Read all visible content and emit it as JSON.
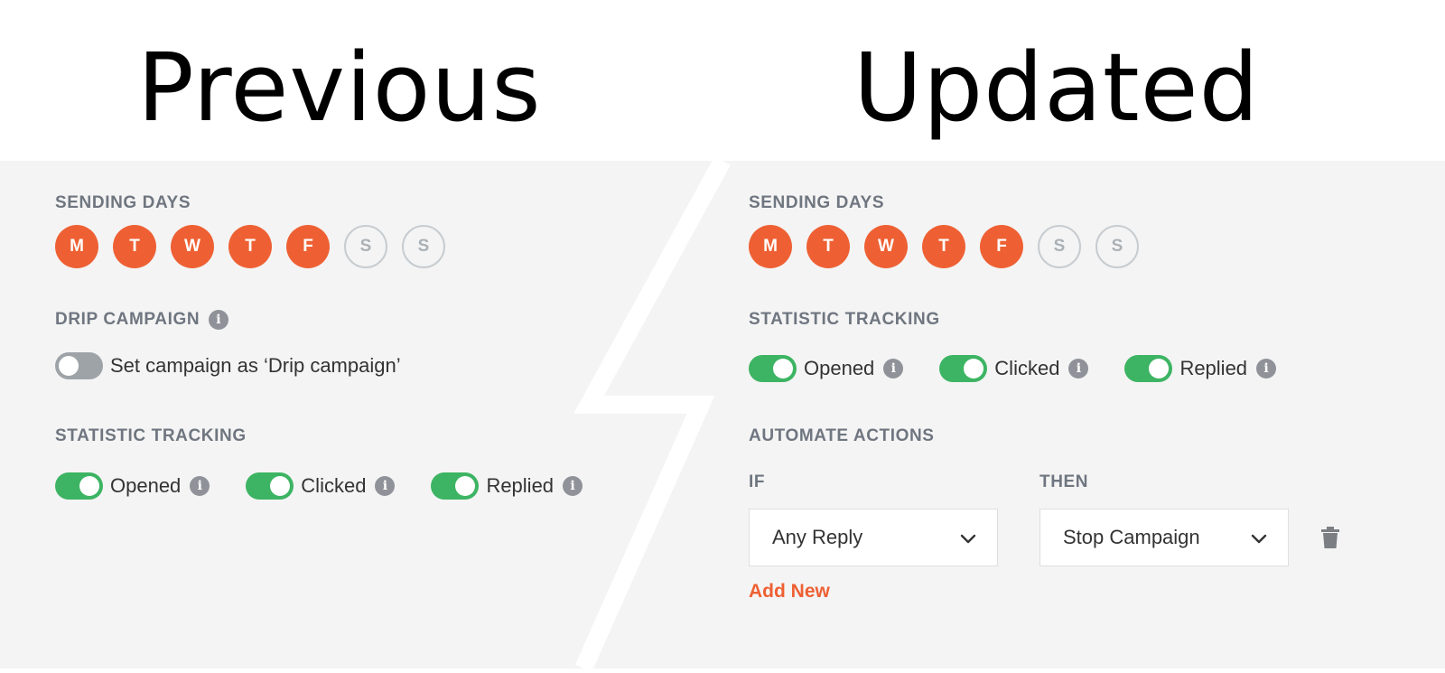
{
  "previous": {
    "heading": "Previous",
    "sending_days": {
      "label": "SENDING DAYS",
      "days": [
        {
          "letter": "M",
          "active": true
        },
        {
          "letter": "T",
          "active": true
        },
        {
          "letter": "W",
          "active": true
        },
        {
          "letter": "T",
          "active": true
        },
        {
          "letter": "F",
          "active": true
        },
        {
          "letter": "S",
          "active": false
        },
        {
          "letter": "S",
          "active": false
        }
      ]
    },
    "drip_campaign": {
      "label": "DRIP CAMPAIGN",
      "toggle_label": "Set campaign as ‘Drip campaign’",
      "enabled": false
    },
    "statistic_tracking": {
      "label": "STATISTIC TRACKING",
      "toggles": [
        {
          "label": "Opened",
          "enabled": true
        },
        {
          "label": "Clicked",
          "enabled": true
        },
        {
          "label": "Replied",
          "enabled": true
        }
      ]
    }
  },
  "updated": {
    "heading": "Updated",
    "sending_days": {
      "label": "SENDING DAYS",
      "days": [
        {
          "letter": "M",
          "active": true
        },
        {
          "letter": "T",
          "active": true
        },
        {
          "letter": "W",
          "active": true
        },
        {
          "letter": "T",
          "active": true
        },
        {
          "letter": "F",
          "active": true
        },
        {
          "letter": "S",
          "active": false
        },
        {
          "letter": "S",
          "active": false
        }
      ]
    },
    "statistic_tracking": {
      "label": "STATISTIC TRACKING",
      "toggles": [
        {
          "label": "Opened",
          "enabled": true
        },
        {
          "label": "Clicked",
          "enabled": true
        },
        {
          "label": "Replied",
          "enabled": true
        }
      ]
    },
    "automate_actions": {
      "label": "AUTOMATE ACTIONS",
      "if_label": "IF",
      "then_label": "THEN",
      "if_value": "Any Reply",
      "then_value": "Stop Campaign",
      "add_new_label": "Add New"
    }
  },
  "icons": {
    "info": "info-icon",
    "chevron": "chevron-down-icon",
    "delete": "trash-icon",
    "info_glyph": "i"
  },
  "colors": {
    "accent": "#ee6033",
    "toggle_on": "#3db463",
    "toggle_off": "#9ea3a8",
    "label": "#6f7680",
    "panel_bg": "#f4f4f4"
  }
}
